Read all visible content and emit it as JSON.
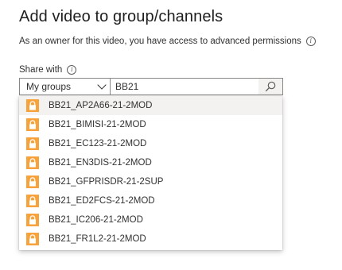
{
  "dialog": {
    "title": "Add video to group/channels",
    "subtitle": "As an owner for this video, you have access to advanced permissions"
  },
  "share": {
    "label": "Share with",
    "scope_selected": "My groups",
    "search_value": "BB21"
  },
  "results": [
    {
      "label": "BB21_AP2A66-21-2MOD"
    },
    {
      "label": "BB21_BIMISI-21-2MOD"
    },
    {
      "label": "BB21_EC123-21-2MOD"
    },
    {
      "label": "BB21_EN3DIS-21-2MOD"
    },
    {
      "label": "BB21_GFPRISDR-21-2SUP"
    },
    {
      "label": "BB21_ED2FCS-21-2MOD"
    },
    {
      "label": "BB21_IC206-21-2MOD"
    },
    {
      "label": "BB21_FR1L2-21-2MOD"
    }
  ],
  "colors": {
    "lock_badge": "#f7a23b",
    "hover_row": "#f3f2f1",
    "border": "#8a8886"
  },
  "icons": {
    "info": "info-icon",
    "dropdown": "chevron-down-icon",
    "search": "search-icon",
    "group": "lock-icon"
  }
}
